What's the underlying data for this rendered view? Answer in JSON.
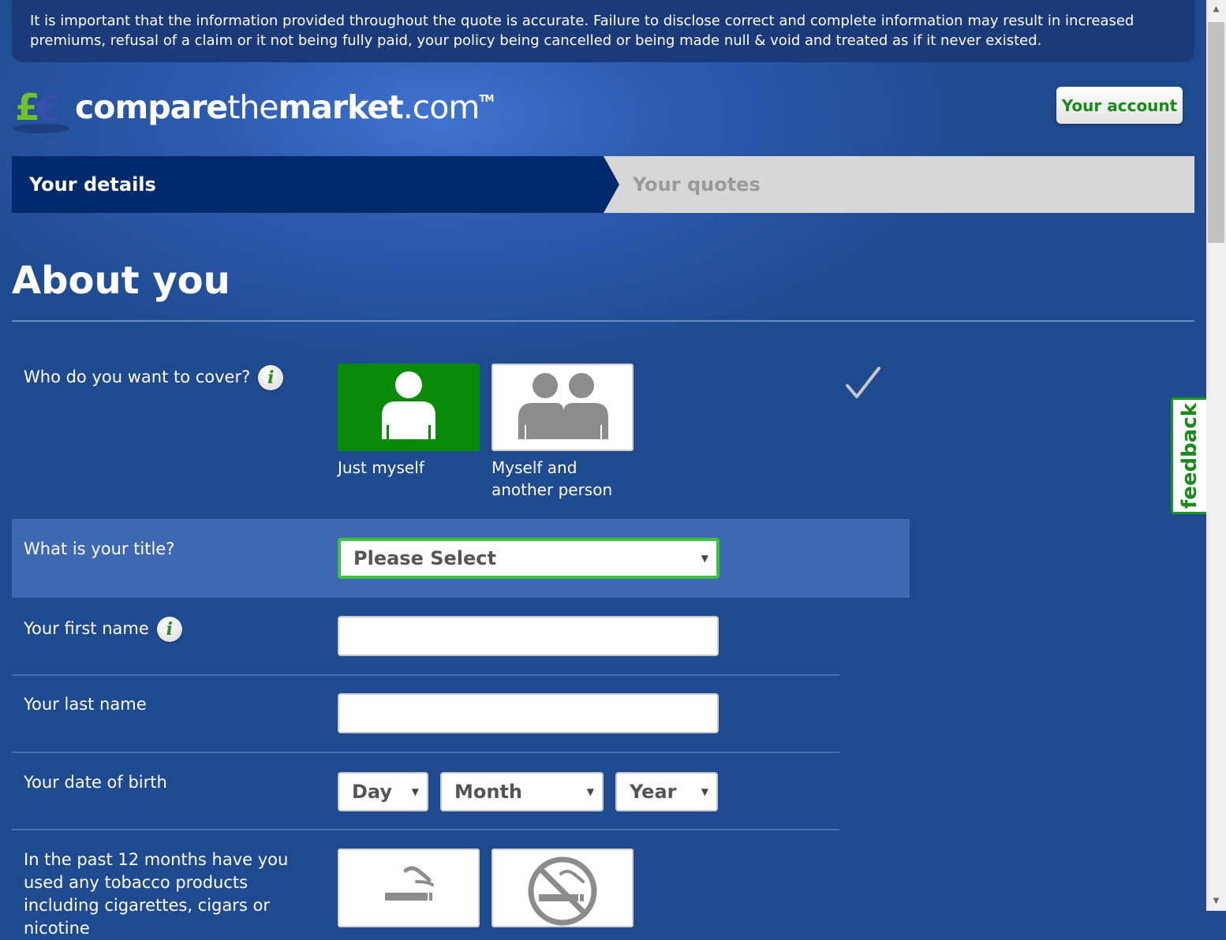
{
  "notice": "It is important that the information provided throughout the quote is accurate. Failure to disclose correct and complete information may result in increased premiums, refusal of a claim or it not being fully paid, your policy being cancelled or being made null & void and treated as if it never existed.",
  "brand": {
    "part1": "compare",
    "part2": "the",
    "part3": "market",
    "part4": ".com",
    "tm": "TM"
  },
  "header": {
    "account_label": "Your account"
  },
  "steps": {
    "active": "Your details",
    "next": "Your quotes"
  },
  "page_title": "About you",
  "questions": {
    "cover": {
      "label": "Who do you want to cover?",
      "options": [
        {
          "label": "Just myself",
          "selected": true
        },
        {
          "label": "Myself and another person",
          "selected": false
        }
      ]
    },
    "title": {
      "label": "What is your title?",
      "value": "Please Select"
    },
    "first_name": {
      "label": "Your first name",
      "value": ""
    },
    "last_name": {
      "label": "Your last name",
      "value": ""
    },
    "dob": {
      "label": "Your date of birth",
      "day": "Day",
      "month": "Month",
      "year": "Year"
    },
    "tobacco": {
      "label": "In the past 12 months have you used any tobacco products including cigarettes, cigars or nicotine"
    }
  },
  "info_icon_glyph": "i",
  "feedback_label": "feedback",
  "colors": {
    "brand_green": "#0a8a0a",
    "page_blue": "#1f4a8f",
    "step_active": "#002a6b"
  }
}
